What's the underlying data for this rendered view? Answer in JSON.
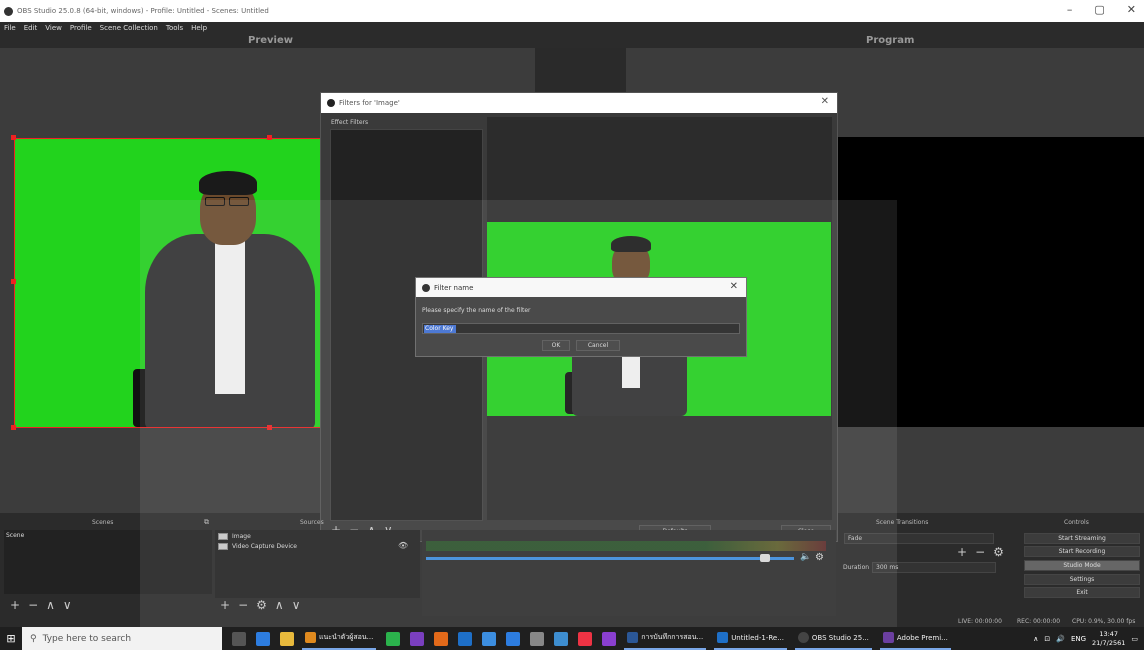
{
  "window": {
    "title": "OBS Studio 25.0.8 (64-bit, windows) - Profile: Untitled - Scenes: Untitled",
    "controls": [
      "–",
      "▢",
      "✕"
    ]
  },
  "menu": [
    "File",
    "Edit",
    "View",
    "Profile",
    "Scene Collection",
    "Tools",
    "Help"
  ],
  "panes": {
    "preview": "Preview",
    "program": "Program"
  },
  "filter_dialog": {
    "title": "Filters for 'Image'",
    "effect_filters_label": "Effect Filters",
    "defaults_label": "Defaults",
    "close_label": "Close"
  },
  "name_dialog": {
    "title": "Filter name",
    "prompt": "Please specify the name of the filter",
    "value": "Color Key",
    "ok_label": "OK",
    "cancel_label": "Cancel"
  },
  "docks": {
    "scenes_title": "Scenes",
    "sources_title": "Sources",
    "transitions_title": "Scene Transitions",
    "controls_title": "Controls"
  },
  "scenes": [
    "Scene"
  ],
  "sources": [
    "Image",
    "Video Capture Device"
  ],
  "transitions": {
    "selected": "Fade",
    "duration_label": "Duration",
    "duration_value": "300 ms"
  },
  "controls": [
    "Start Streaming",
    "Start Recording",
    "Studio Mode",
    "Settings",
    "Exit"
  ],
  "status": {
    "live": "LIVE: 00:00:00",
    "rec": "REC: 00:00:00",
    "cpu": "CPU: 0.9%, 30.00 fps"
  },
  "taskbar": {
    "search_placeholder": "Type here to search",
    "apps": [
      {
        "label": "แนะนำตัวผู้สอน...",
        "color": "#e08a1f"
      },
      {
        "label": "การบันทึกการสอน...",
        "color": "#2b5797"
      },
      {
        "label": "Untitled-1-Re...",
        "color": "#1e6fc7"
      },
      {
        "label": "OBS Studio 25...",
        "color": "#444444"
      },
      {
        "label": "Adobe Premi...",
        "color": "#6b3fa0"
      }
    ],
    "lang": "ENG",
    "time": "13:47",
    "date": "21/7/2561"
  },
  "mixer": {
    "volume_fraction": 0.83
  }
}
